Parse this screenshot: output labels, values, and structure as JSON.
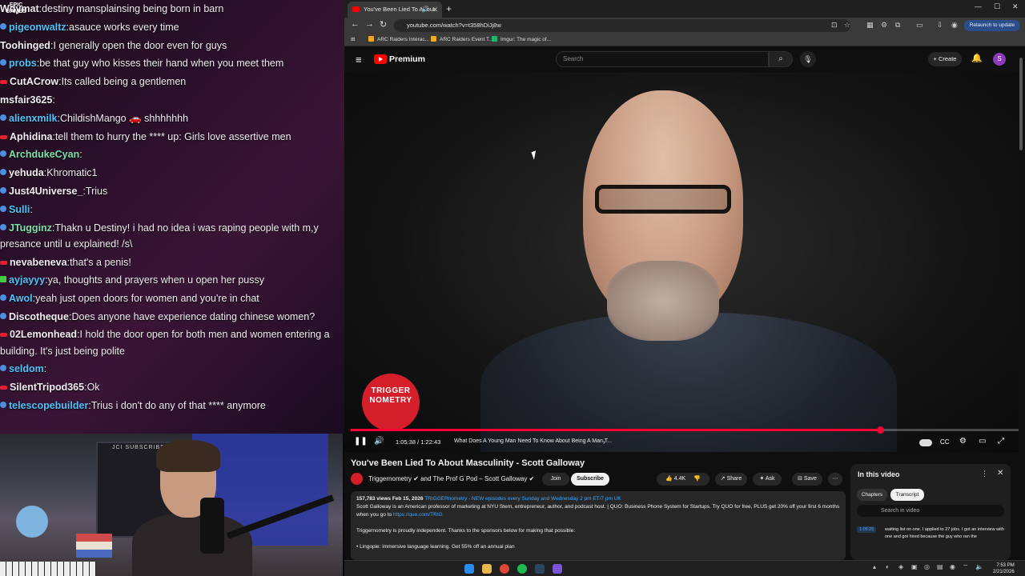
{
  "chat": {
    "logo_text": "EPIC\nGAMES",
    "logo_sub": "Epic Games",
    "messages": [
      {
        "user": "Wdymat",
        "text": "destiny mansplainsing being born in barn",
        "color": "#f2eef3",
        "badge": "none"
      },
      {
        "user": "pigeonwaltz",
        "text": "asauce works every time",
        "color": "#4fc3f7",
        "badge": "blue"
      },
      {
        "user": "Toohinged",
        "text": "I generally open the door even for guys",
        "color": "#f2eef3",
        "badge": "none"
      },
      {
        "user": "probs",
        "text": "be that guy who kisses their hand when you meet them",
        "color": "#4fc3f7",
        "badge": "blue"
      },
      {
        "user": "CutACrow",
        "text": "Its called being a gentlemen",
        "color": "#f2eef3",
        "badge": "red"
      },
      {
        "user": "msfair3625",
        "text": "",
        "color": "#f2eef3",
        "badge": "none"
      },
      {
        "user": "alienxmilk",
        "text": "ChildishMango 🚗 shhhhhhh",
        "color": "#4fc3f7",
        "badge": "blue"
      },
      {
        "user": "Aphidina",
        "text": "tell them to hurry the **** up: Girls love assertive men",
        "color": "#f2eef3",
        "badge": "red"
      },
      {
        "user": "ArchdukeCyan",
        "text": "",
        "color": "#7ee0a8",
        "badge": "blue"
      },
      {
        "user": "yehuda",
        "text": "Khromatic1",
        "color": "#f2eef3",
        "badge": "blue"
      },
      {
        "user": "Just4Universe_",
        "text": "Trius",
        "color": "#f2eef3",
        "badge": "blue"
      },
      {
        "user": "Sulli",
        "text": "",
        "color": "#4fc3f7",
        "badge": "blue"
      },
      {
        "user": "JTugginz",
        "text": "Thakn u Destiny! i had no idea i was raping people with m,y presance until u explained! /s\\",
        "color": "#7ee0a8",
        "badge": "blue",
        "wrap": true
      },
      {
        "user": "nevabeneva",
        "text": "that's a penis!",
        "color": "#f2eef3",
        "badge": "red"
      },
      {
        "user": "ayjayyy",
        "text": "ya, thoughts and prayers when u open her pussy",
        "color": "#4fc3f7",
        "badge": "green"
      },
      {
        "user": "Awol",
        "text": "yeah just open doors for women and you're in chat",
        "color": "#4fc3f7",
        "badge": "blue"
      },
      {
        "user": "Discotheque",
        "text": "Does anyone have experience dating chinese women?",
        "color": "#f2eef3",
        "badge": "blue",
        "wrap": true
      },
      {
        "user": "02Lemonhead",
        "text": "I hold the door open for both men and women entering a building. It's just being polite",
        "color": "#f2eef3",
        "badge": "red",
        "wrap": true
      },
      {
        "user": "seldom",
        "text": "",
        "color": "#4fc3f7",
        "badge": "blue"
      },
      {
        "user": "SilentTripod365",
        "text": "Ok",
        "color": "#f2eef3",
        "badge": "red"
      },
      {
        "user": "telescopebuilder",
        "text": "Trius i don't do any of that **** anymore",
        "color": "#4fc3f7",
        "badge": "blue"
      }
    ]
  },
  "webcam": {
    "sign_text": "JCI SUBSCRIBER"
  },
  "browser": {
    "tab_title": "You've Been Lied To About",
    "url": "youtube.com/watch?v=t358hDiJj8w",
    "relaunch": "Relaunch to update",
    "bookmarks": [
      "ARC Raiders Interac...",
      "ARC Raiders Event T...",
      "Imgur: The magic of..."
    ]
  },
  "youtube": {
    "brand": "Premium",
    "search_placeholder": "Search",
    "create_label": "+ Create",
    "avatar_letter": "S",
    "player": {
      "logo_text": "TRIGGER NOMETRY",
      "time": "1:05:38 / 1:22:43",
      "chapter": "What Does A Young Man Need To Know About Being A Man T...",
      "progress": 0.793
    },
    "video_title": "You've Been Lied To About Masculinity - Scott Galloway",
    "channel": "Triggernometry ✔ and The Prof G Pod – Scott Galloway ✔",
    "join": "Join",
    "subscribe": "Subscribe",
    "likes": "4.4K",
    "share": "Share",
    "ask": "Ask",
    "save": "Save",
    "description": {
      "meta": "157,783 views  Feb 15, 2026",
      "meta_link": "TRIGGERnometry - NEW episodes every Sunday and Wednesday 2 pm ET/7 pm UK",
      "line1": "Scott Galloway is an American professor of marketing at NYU Stern, entrepreneur, author, and podcast host. | QUO: Business Phone System for Startups. Try QUO for free, PLUS get 20% off your first 6 months when you go to",
      "link1": "https://quo.com/TRIG",
      "line2": "Triggernometry is proudly independent. Thanks to the sponsors below for making that possible:",
      "line3": "• Lingopie: immersive language learning. Get 55% off an annual plan"
    },
    "side_panel": {
      "title": "In this video",
      "chapters": "Chapters",
      "transcript": "Transcript",
      "search_placeholder": "Search in video",
      "timestamp": "1:05:25",
      "line": "waiting list on one. I applied to 27 jobs. I got an interview with one and got hired because the guy who ran the"
    }
  },
  "taskbar": {
    "time": "7:53 PM",
    "date": "2/21/2026"
  },
  "colors": {
    "yt_red": "#ff0033",
    "trig_red": "#d41f2b",
    "link_blue": "#3ea6ff"
  }
}
